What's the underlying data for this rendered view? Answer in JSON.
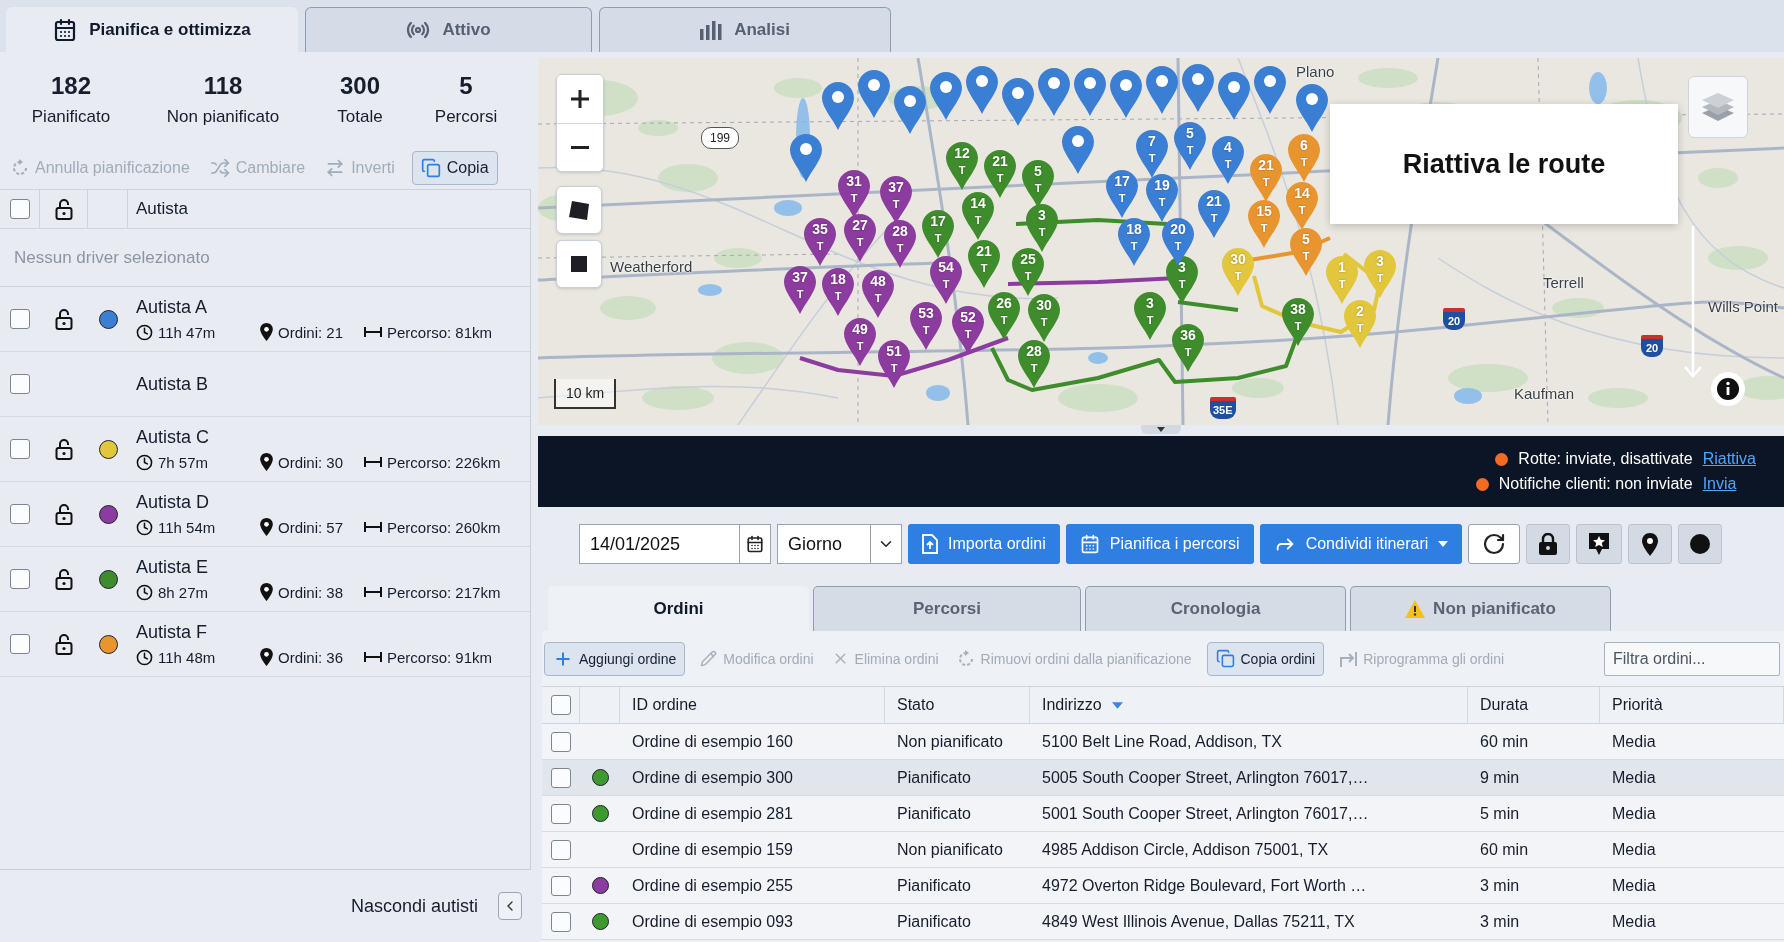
{
  "top_tabs": [
    {
      "label": "Pianifica e ottimizza",
      "selected": true
    },
    {
      "label": "Attivo",
      "selected": false
    },
    {
      "label": "Analisi",
      "selected": false
    }
  ],
  "summary": [
    {
      "value": "182",
      "label": "Pianificato"
    },
    {
      "value": "118",
      "label": "Non pianificato"
    },
    {
      "value": "300",
      "label": "Totale"
    },
    {
      "value": "5",
      "label": "Percorsi"
    }
  ],
  "driver_actions": [
    {
      "label": "Annulla pianificazione",
      "disabled": true
    },
    {
      "label": "Cambiare",
      "disabled": true
    },
    {
      "label": "Inverti",
      "disabled": true
    },
    {
      "label": "Copia",
      "disabled": false
    }
  ],
  "drivers_table": {
    "header": {
      "checked": false,
      "label": "Autista"
    },
    "empty_message": "Nessun driver selezionato",
    "drivers": [
      {
        "kind": "assigned",
        "checked": false,
        "color": "#3b7fd4",
        "name": "Autista A",
        "time": "11h 47m",
        "orders": "Ordini: 21",
        "distance": "Percorso: 81km"
      },
      {
        "kind": "unassigned",
        "checked": false,
        "name": "Autista B"
      },
      {
        "kind": "assigned",
        "checked": false,
        "color": "#e2c63c",
        "name": "Autista C",
        "time": "7h 57m",
        "orders": "Ordini: 30",
        "distance": "Percorso: 226km"
      },
      {
        "kind": "assigned",
        "checked": false,
        "color": "#8c3b9e",
        "name": "Autista D",
        "time": "11h 54m",
        "orders": "Ordini: 57",
        "distance": "Percorso: 260km"
      },
      {
        "kind": "assigned",
        "checked": false,
        "color": "#3e8c2c",
        "name": "Autista E",
        "time": "8h 27m",
        "orders": "Ordini: 38",
        "distance": "Percorso: 217km"
      },
      {
        "kind": "assigned",
        "checked": false,
        "color": "#e8952f",
        "name": "Autista F",
        "time": "11h 48m",
        "orders": "Ordini: 36",
        "distance": "Percorso: 91km"
      }
    ]
  },
  "hide_drivers": "Nascondi autisti",
  "map": {
    "places": [
      "Plano",
      "Weatherford",
      "Terrell",
      "Wills Point",
      "Kaufman"
    ],
    "shields": [
      {
        "kind": "state",
        "label": "199"
      },
      {
        "kind": "interstate",
        "label": "20"
      },
      {
        "kind": "interstate",
        "label": "20"
      },
      {
        "kind": "interstate",
        "label": "35E"
      }
    ],
    "scale": "10 km",
    "tooltip": "Riattiva le route",
    "routes": [
      {
        "color": "#8c3b9e"
      },
      {
        "color": "#3e8c2c"
      },
      {
        "color": "#e2c63c"
      },
      {
        "color": "#e8952f"
      }
    ],
    "markers": [
      {
        "kind": "pin",
        "color": "#3b7fd4"
      },
      {
        "kind": "pin",
        "color": "#3b7fd4"
      },
      {
        "kind": "pin",
        "color": "#3b7fd4"
      },
      {
        "kind": "pin",
        "color": "#3b7fd4"
      },
      {
        "kind": "pin",
        "color": "#3b7fd4"
      },
      {
        "kind": "pin",
        "color": "#3b7fd4"
      },
      {
        "kind": "pin",
        "color": "#3b7fd4"
      },
      {
        "kind": "pin",
        "color": "#3b7fd4"
      },
      {
        "kind": "pin",
        "color": "#3b7fd4"
      },
      {
        "kind": "pin",
        "color": "#3b7fd4"
      },
      {
        "kind": "pin",
        "color": "#3b7fd4"
      },
      {
        "kind": "pin",
        "color": "#3b7fd4"
      },
      {
        "kind": "pin",
        "color": "#3b7fd4"
      },
      {
        "kind": "pin",
        "color": "#3b7fd4"
      },
      {
        "kind": "pin",
        "color": "#3b7fd4"
      },
      {
        "kind": "pin",
        "color": "#3b7fd4"
      },
      {
        "kind": "numbered",
        "label": "31",
        "sub": "T",
        "color": "#8c3b9e"
      },
      {
        "kind": "numbered",
        "label": "37",
        "sub": "T",
        "color": "#8c3b9e"
      },
      {
        "kind": "numbered",
        "label": "35",
        "sub": "T",
        "color": "#8c3b9e"
      },
      {
        "kind": "numbered",
        "label": "27",
        "sub": "T",
        "color": "#8c3b9e"
      },
      {
        "kind": "numbered",
        "label": "28",
        "sub": "T",
        "color": "#8c3b9e"
      },
      {
        "kind": "numbered",
        "label": "54",
        "sub": "T",
        "color": "#8c3b9e"
      },
      {
        "kind": "numbered",
        "label": "37",
        "sub": "T",
        "color": "#8c3b9e"
      },
      {
        "kind": "numbered",
        "label": "18",
        "sub": "T",
        "color": "#8c3b9e"
      },
      {
        "kind": "numbered",
        "label": "48",
        "sub": "T",
        "color": "#8c3b9e"
      },
      {
        "kind": "numbered",
        "label": "53",
        "sub": "T",
        "color": "#8c3b9e"
      },
      {
        "kind": "numbered",
        "label": "52",
        "sub": "T",
        "color": "#8c3b9e"
      },
      {
        "kind": "numbered",
        "label": "49",
        "sub": "T",
        "color": "#8c3b9e"
      },
      {
        "kind": "numbered",
        "label": "51",
        "sub": "T",
        "color": "#8c3b9e"
      },
      {
        "kind": "numbered",
        "label": "12",
        "sub": "T",
        "color": "#3e8c2c"
      },
      {
        "kind": "numbered",
        "label": "21",
        "sub": "T",
        "color": "#3e8c2c"
      },
      {
        "kind": "numbered",
        "label": "5",
        "sub": "T",
        "color": "#3e8c2c"
      },
      {
        "kind": "numbered",
        "label": "14",
        "sub": "T",
        "color": "#3e8c2c"
      },
      {
        "kind": "numbered",
        "label": "17",
        "sub": "T",
        "color": "#3e8c2c"
      },
      {
        "kind": "numbered",
        "label": "3",
        "sub": "T",
        "color": "#3e8c2c"
      },
      {
        "kind": "numbered",
        "label": "21",
        "sub": "T",
        "color": "#3e8c2c"
      },
      {
        "kind": "numbered",
        "label": "25",
        "sub": "T",
        "color": "#3e8c2c"
      },
      {
        "kind": "numbered",
        "label": "26",
        "sub": "T",
        "color": "#3e8c2c"
      },
      {
        "kind": "numbered",
        "label": "30",
        "sub": "T",
        "color": "#3e8c2c"
      },
      {
        "kind": "numbered",
        "label": "28",
        "sub": "T",
        "color": "#3e8c2c"
      },
      {
        "kind": "numbered",
        "label": "3",
        "sub": "T",
        "color": "#3e8c2c"
      },
      {
        "kind": "numbered",
        "label": "3",
        "sub": "T",
        "color": "#3e8c2c"
      },
      {
        "kind": "numbered",
        "label": "36",
        "sub": "T",
        "color": "#3e8c2c"
      },
      {
        "kind": "numbered",
        "label": "38",
        "sub": "T",
        "color": "#3e8c2c"
      },
      {
        "kind": "numbered",
        "label": "7",
        "sub": "T",
        "color": "#3b7fd4"
      },
      {
        "kind": "numbered",
        "label": "5",
        "sub": "T",
        "color": "#3b7fd4"
      },
      {
        "kind": "numbered",
        "label": "4",
        "sub": "T",
        "color": "#3b7fd4"
      },
      {
        "kind": "numbered",
        "label": "17",
        "sub": "T",
        "color": "#3b7fd4"
      },
      {
        "kind": "numbered",
        "label": "19",
        "sub": "T",
        "color": "#3b7fd4"
      },
      {
        "kind": "numbered",
        "label": "18",
        "sub": "T",
        "color": "#3b7fd4"
      },
      {
        "kind": "numbered",
        "label": "20",
        "sub": "T",
        "color": "#3b7fd4"
      },
      {
        "kind": "numbered",
        "label": "21",
        "sub": "T",
        "color": "#3b7fd4"
      },
      {
        "kind": "numbered",
        "label": "21",
        "sub": "T",
        "color": "#e8952f"
      },
      {
        "kind": "numbered",
        "label": "6",
        "sub": "T",
        "color": "#e8952f"
      },
      {
        "kind": "numbered",
        "label": "14",
        "sub": "T",
        "color": "#e8952f"
      },
      {
        "kind": "numbered",
        "label": "15",
        "sub": "T",
        "color": "#e8952f"
      },
      {
        "kind": "numbered",
        "label": "5",
        "sub": "T",
        "color": "#e8952f"
      },
      {
        "kind": "numbered",
        "label": "30",
        "sub": "T",
        "color": "#e2c63c"
      },
      {
        "kind": "numbered",
        "label": "1",
        "sub": "T",
        "color": "#e2c63c"
      },
      {
        "kind": "numbered",
        "label": "3",
        "sub": "T",
        "color": "#e2c63c"
      },
      {
        "kind": "numbered",
        "label": "2",
        "sub": "T",
        "color": "#e2c63c"
      }
    ]
  },
  "notices": [
    {
      "text": "Rotte: inviate, disattivate",
      "link": "Riattiva"
    },
    {
      "text": "Notifiche clienti: non inviate",
      "link": "Invia"
    }
  ],
  "toolbar": {
    "date": "14/01/2025",
    "period": "Giorno",
    "actions": [
      {
        "label": "Importa ordini",
        "dropdown": false
      },
      {
        "label": "Pianifica i percorsi",
        "dropdown": false
      },
      {
        "label": "Condividi itinerari",
        "dropdown": true
      }
    ]
  },
  "order_tabs": [
    {
      "label": "Ordini",
      "selected": true,
      "warning": false
    },
    {
      "label": "Percorsi",
      "selected": false,
      "warning": false
    },
    {
      "label": "Cronologia",
      "selected": false,
      "warning": false
    },
    {
      "label": "Non pianificato",
      "selected": false,
      "warning": true
    }
  ],
  "order_actions": [
    {
      "label": "Aggiungi ordine",
      "disabled": false
    },
    {
      "label": "Modifica ordini",
      "disabled": true
    },
    {
      "label": "Elimina ordini",
      "disabled": true
    },
    {
      "label": "Rimuovi ordini dalla pianificazione",
      "disabled": true
    },
    {
      "label": "Copia ordini",
      "disabled": false
    },
    {
      "label": "Riprogramma gli ordini",
      "disabled": true
    }
  ],
  "filter": {
    "placeholder": "Filtra ordini..."
  },
  "orders_table": {
    "header_checked": false,
    "columns": [
      {
        "label": "ID ordine",
        "sorted": false
      },
      {
        "label": "Stato",
        "sorted": false
      },
      {
        "label": "Indirizzo",
        "sorted": true
      },
      {
        "label": "Durata",
        "sorted": false
      },
      {
        "label": "Priorità",
        "sorted": false
      }
    ],
    "rows": [
      {
        "checked": false,
        "selected": false,
        "id": "Ordine di esempio 160",
        "status": "Non pianificato",
        "address": "5100 Belt Line Road, Addison, TX",
        "duration": "60 min",
        "priority": "Media"
      },
      {
        "checked": false,
        "selected": true,
        "color": "#3e9a2e",
        "id": "Ordine di esempio 300",
        "status": "Pianificato",
        "address": "5005 South Cooper Street, Arlington 76017,…",
        "duration": "9 min",
        "priority": "Media"
      },
      {
        "checked": false,
        "selected": false,
        "color": "#3e9a2e",
        "id": "Ordine di esempio 281",
        "status": "Pianificato",
        "address": "5001 South Cooper Street, Arlington 76017,…",
        "duration": "5 min",
        "priority": "Media"
      },
      {
        "checked": false,
        "selected": false,
        "id": "Ordine di esempio 159",
        "status": "Non pianificato",
        "address": "4985 Addison Circle, Addison 75001, TX",
        "duration": "60 min",
        "priority": "Media"
      },
      {
        "checked": false,
        "selected": false,
        "color": "#8c3b9e",
        "id": "Ordine di esempio 255",
        "status": "Pianificato",
        "address": "4972 Overton Ridge Boulevard, Fort Worth …",
        "duration": "3 min",
        "priority": "Media"
      },
      {
        "checked": false,
        "selected": false,
        "color": "#3e9a2e",
        "id": "Ordine di esempio 093",
        "status": "Pianificato",
        "address": "4849 West Illinois Avenue, Dallas 75211, TX",
        "duration": "3 min",
        "priority": "Media"
      }
    ]
  }
}
